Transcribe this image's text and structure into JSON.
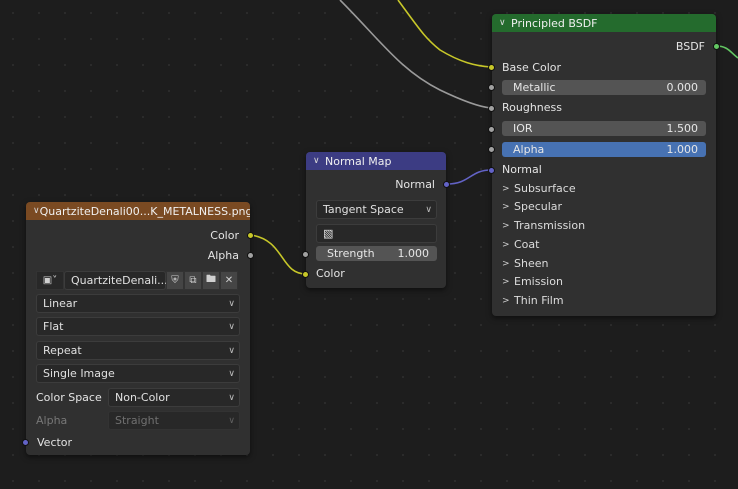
{
  "image_node": {
    "title": "QuartziteDenali00...K_METALNESS.png",
    "header_color": "#7a4a22",
    "outputs": [
      "Color",
      "Alpha"
    ],
    "image_name": "QuartziteDenali...",
    "interpolation": "Linear",
    "projection": "Flat",
    "extension": "Repeat",
    "source": "Single Image",
    "color_space_label": "Color Space",
    "color_space_value": "Non-Color",
    "alpha_label": "Alpha",
    "alpha_value": "Straight",
    "input_vector": "Vector",
    "icons": [
      "image-type-icon",
      "shield-icon",
      "duplicate-icon",
      "folder-icon",
      "close-icon"
    ]
  },
  "normal_map_node": {
    "title": "Normal Map",
    "header_color": "#3c3c83",
    "output": "Normal",
    "space": "Tangent Space",
    "strength_label": "Strength",
    "strength_value": "1.000",
    "input_color": "Color",
    "icons": [
      "uv-map-icon"
    ]
  },
  "bsdf_node": {
    "title": "Principled BSDF",
    "header_color": "#246b2d",
    "output": "BSDF",
    "base_color": "Base Color",
    "metallic_label": "Metallic",
    "metallic_value": "0.000",
    "roughness": "Roughness",
    "ior_label": "IOR",
    "ior_value": "1.500",
    "alpha_label": "Alpha",
    "alpha_value": "1.000",
    "normal": "Normal",
    "panels": [
      "Subsurface",
      "Specular",
      "Transmission",
      "Coat",
      "Sheen",
      "Emission",
      "Thin Film"
    ]
  },
  "colors": {
    "socket_color": "#c7c729",
    "socket_float": "#a1a1a1",
    "socket_vector": "#6363c7",
    "socket_shader": "#63c763",
    "active_field": "#4772b3"
  }
}
